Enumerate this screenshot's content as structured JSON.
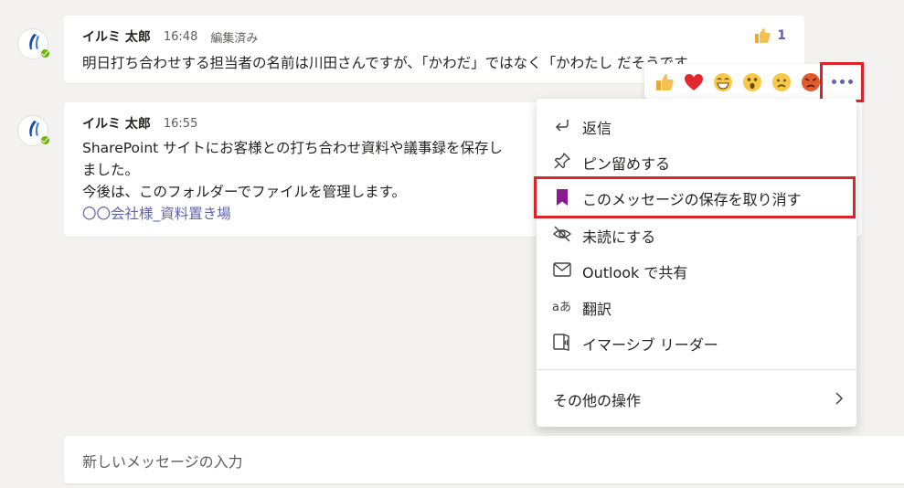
{
  "messages": [
    {
      "author": "イルミ 太郎",
      "time": "16:48",
      "edited": "編集済み",
      "lines": [
        "明日打ち合わせする担当者の名前は川田さんですが、「かわだ」ではなく「かわたし だそうです"
      ],
      "reaction": {
        "icon": "thumbs-up-icon",
        "count": "1"
      }
    },
    {
      "author": "イルミ 太郎",
      "time": "16:55",
      "lines": [
        "SharePoint サイトにお客様との打ち合わせ資料や議事録を保存し",
        "ました。",
        "今後は、このフォルダーでファイルを管理します。"
      ],
      "link": "〇〇会社様_資料置き場"
    }
  ],
  "reaction_bar": {
    "items": [
      "like",
      "heart",
      "laugh",
      "surprised",
      "sad",
      "angry"
    ],
    "more": "more-options-icon"
  },
  "context_menu": {
    "items": [
      {
        "label": "返信",
        "icon": "reply-icon"
      },
      {
        "label": "ピン留めする",
        "icon": "pin-icon"
      },
      {
        "label": "このメッセージの保存を取り消す",
        "icon": "bookmark-icon"
      },
      {
        "label": "未読にする",
        "icon": "unread-icon"
      },
      {
        "label": "Outlook で共有",
        "icon": "mail-icon"
      },
      {
        "label": "翻訳",
        "icon": "translate-icon"
      },
      {
        "label": "イマーシブ リーダー",
        "icon": "immersive-reader-icon"
      }
    ],
    "more_actions": "その他の操作"
  },
  "compose": {
    "placeholder": "新しいメッセージの入力"
  },
  "colors": {
    "accent": "#6264a7",
    "highlight": "#d9252a",
    "presence": "#6bb700"
  }
}
